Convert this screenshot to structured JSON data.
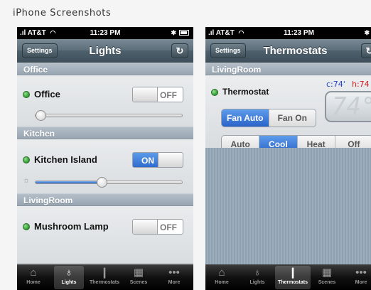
{
  "page": {
    "heading": "iPhone Screenshots"
  },
  "status": {
    "carrier": "AT&T",
    "time": "11:23 PM"
  },
  "lights_screen": {
    "settings_label": "Settings",
    "title": "Lights",
    "refresh_glyph": "↻",
    "sections": [
      {
        "name": "Office",
        "device": "Office",
        "switch": "OFF",
        "switch_on": false,
        "dimmer_level": 0.0
      },
      {
        "name": "Kitchen",
        "device": "Kitchen Island",
        "switch": "ON",
        "switch_on": true,
        "dimmer_level": 0.45
      },
      {
        "name": "LivingRoom",
        "device": "Mushroom Lamp",
        "switch": "OFF",
        "switch_on": false
      }
    ]
  },
  "thermostats_screen": {
    "settings_label": "Settings",
    "title": "Thermostats",
    "refresh_glyph": "↻",
    "section": "LivingRoom",
    "device": "Thermostat",
    "cool_setpoint": "c:74'",
    "heat_setpoint": "h:74",
    "display_temp": "74°",
    "fan_modes": [
      "Fan Auto",
      "Fan On"
    ],
    "fan_selected": "Fan Auto",
    "modes": [
      "Auto",
      "Cool",
      "Heat",
      "Off"
    ],
    "mode_selected": "Cool",
    "colors": {
      "cool": "#2244cc",
      "heat": "#d11a1a"
    }
  },
  "tabbar": {
    "tabs": [
      {
        "label": "Home",
        "icon": "home-icon"
      },
      {
        "label": "Lights",
        "icon": "bulb-icon"
      },
      {
        "label": "Thermostats",
        "icon": "thermometer-icon"
      },
      {
        "label": "Scenes",
        "icon": "clapper-icon"
      },
      {
        "label": "More",
        "icon": "more-icon"
      }
    ],
    "left_active": "Lights",
    "right_active": "Thermostats"
  }
}
